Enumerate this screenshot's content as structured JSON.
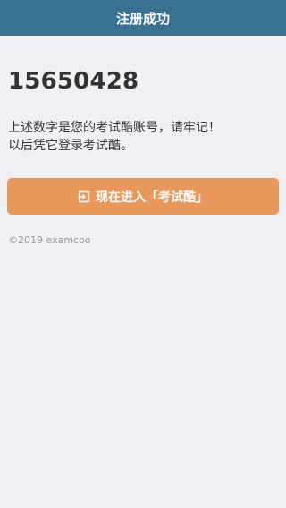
{
  "header": {
    "title": "注册成功"
  },
  "account": {
    "number": "15650428"
  },
  "notice": {
    "line1": "上述数字是您的考试酷账号，请牢记！",
    "line2": "以后凭它登录考试酷。"
  },
  "enter_button": {
    "label": "现在进入「考试酷」",
    "icon": "sign-in-icon"
  },
  "footer": {
    "copyright": "©2019 examcoo"
  },
  "colors": {
    "header_bg": "#3a7193",
    "button_bg": "#e8985a",
    "page_bg": "#efeff4"
  }
}
